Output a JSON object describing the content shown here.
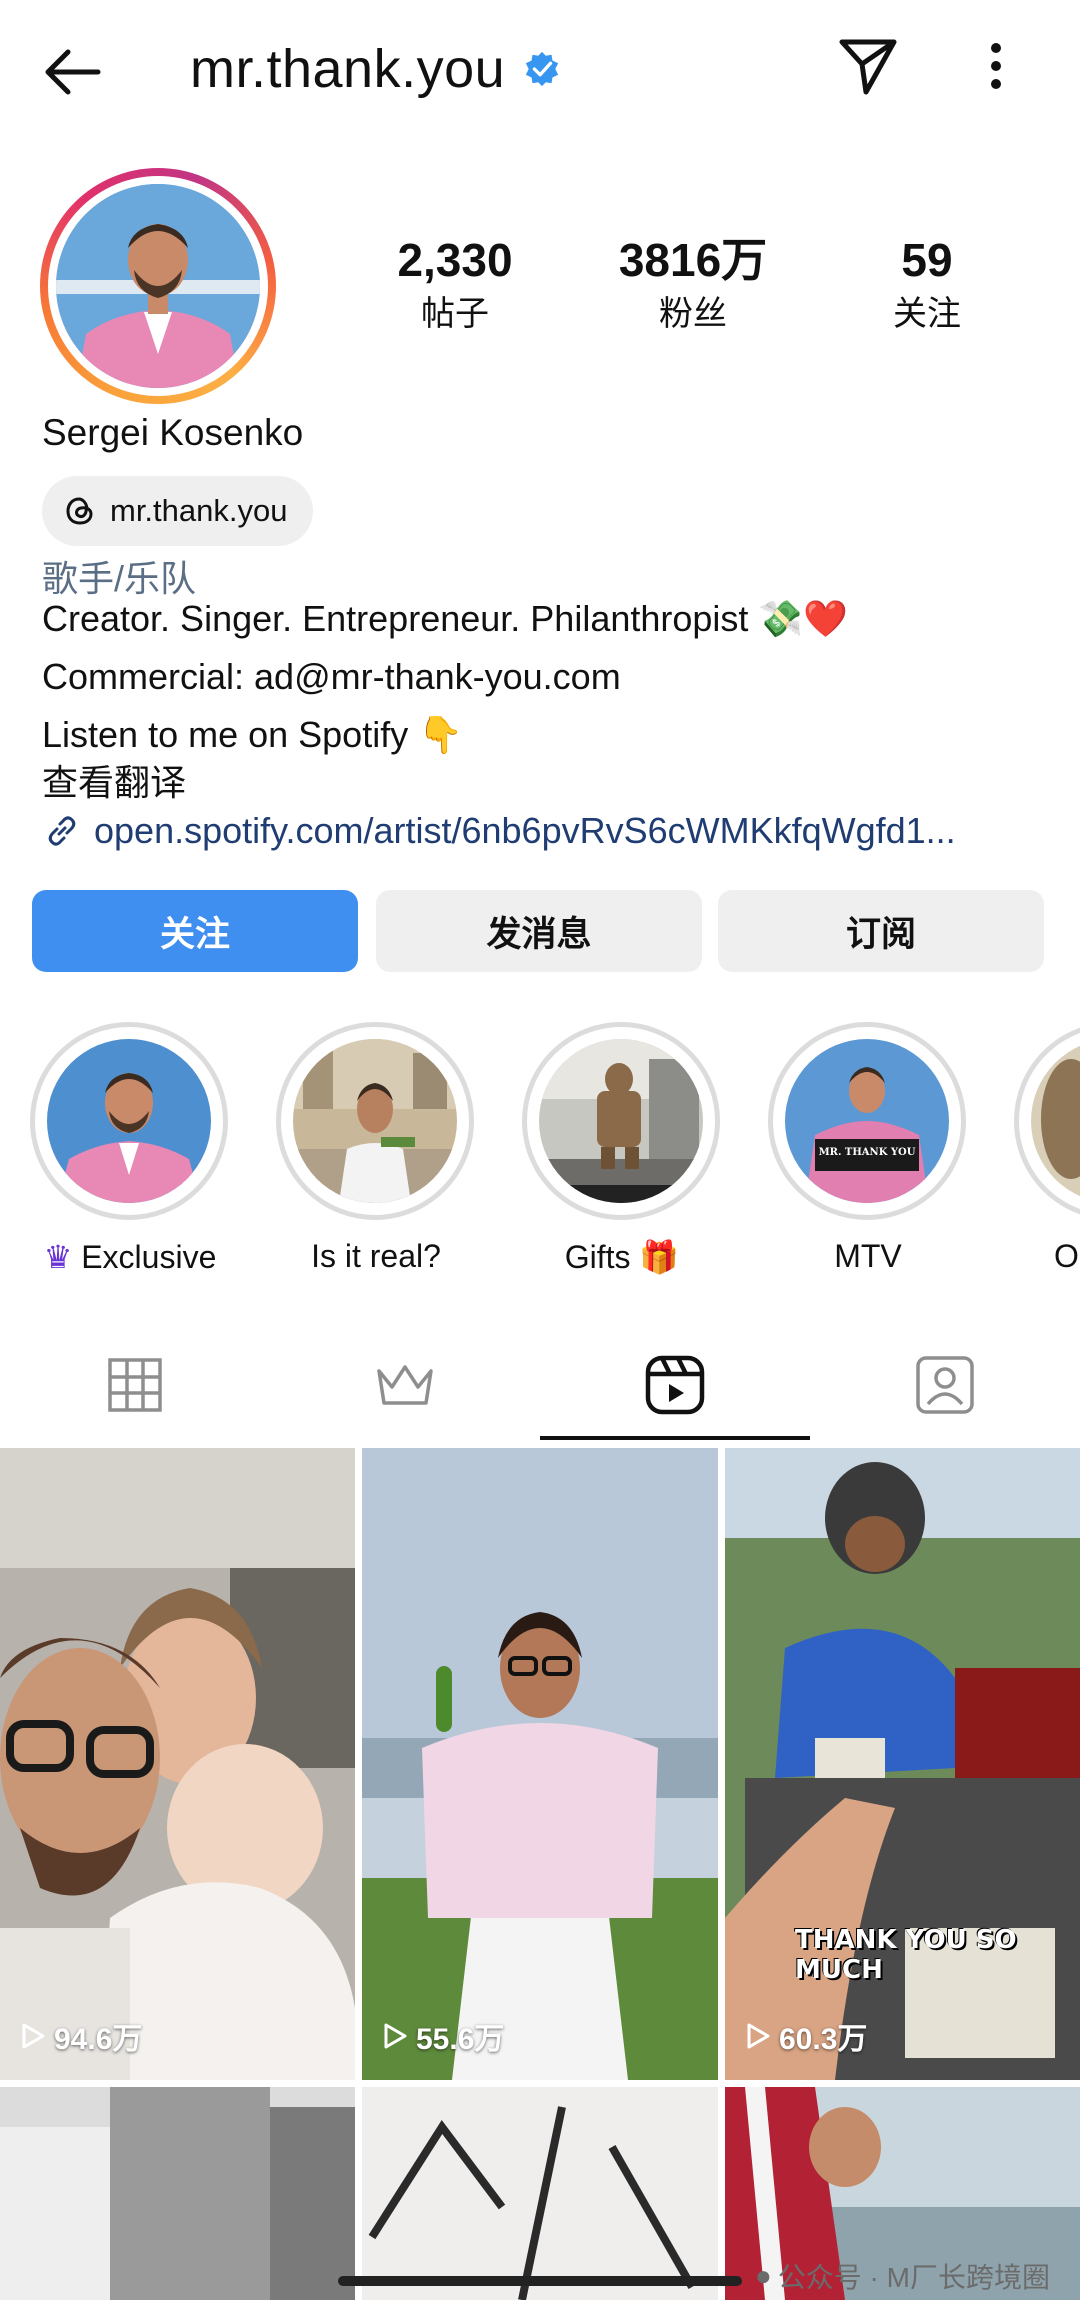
{
  "header": {
    "username": "mr.thank.you",
    "back_icon": "arrow-left-icon",
    "verified_icon": "verified-badge-icon",
    "send_icon": "paper-plane-icon",
    "more_icon": "more-vertical-icon"
  },
  "profile": {
    "stats": [
      {
        "value": "2,330",
        "label": "帖子"
      },
      {
        "value": "3816万",
        "label": "粉丝"
      },
      {
        "value": "59",
        "label": "关注"
      }
    ],
    "full_name": "Sergei Kosenko",
    "threads_handle": "mr.thank.you",
    "category": "歌手/乐队",
    "bio": [
      "Creator. Singer. Entrepreneur. Philanthropist 💸❤️",
      "Commercial: ad@mr-thank-you.com",
      "Listen to me on Spotify 👇",
      "查看翻译"
    ],
    "link": "open.spotify.com/artist/6nb6pvRvS6cWMKkfqWgfd1..."
  },
  "actions": {
    "follow": "关注",
    "message": "发消息",
    "subscribe": "订阅"
  },
  "highlights": [
    {
      "label": "Exclusive",
      "prefix": "♛"
    },
    {
      "label": "Is it real?",
      "prefix": ""
    },
    {
      "label": "Gifts 🎁",
      "prefix": ""
    },
    {
      "label": "MTV",
      "prefix": ""
    },
    {
      "label": "O",
      "prefix": ""
    }
  ],
  "highlight_mtv_sign": "MR. THANK YOU",
  "tabs": [
    "grid-icon",
    "crown-icon",
    "reels-icon",
    "tagged-icon"
  ],
  "active_tab": 2,
  "posts": [
    {
      "views": "94.6万"
    },
    {
      "views": "55.6万"
    },
    {
      "views": "60.3万",
      "overlay": "THANK YOU SO MUCH"
    }
  ],
  "watermark": "公众号 · M厂长跨境圈",
  "colors": {
    "follow_button": "#3e8ff0",
    "secondary_button": "#efefef",
    "link": "#1f3d72",
    "category": "#5a6e85",
    "verified": "#3797f0"
  }
}
